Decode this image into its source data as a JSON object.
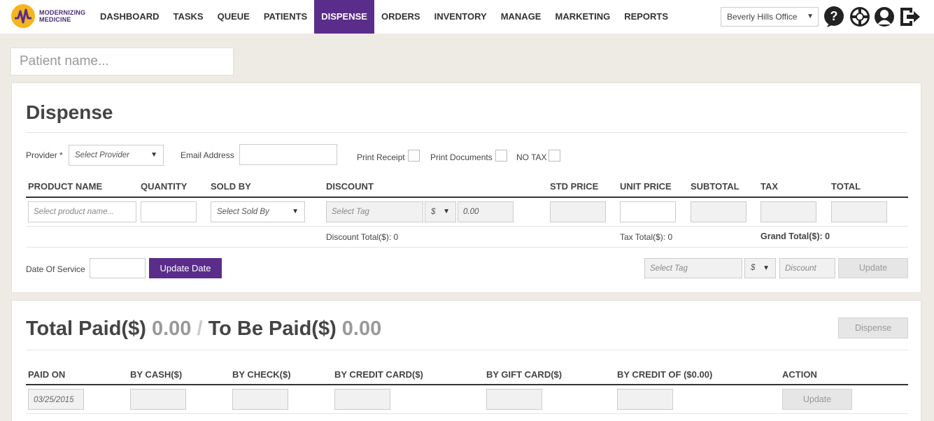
{
  "brand": {
    "line1": "MODERNIZING",
    "line2": "MEDICINE"
  },
  "nav": {
    "items": [
      {
        "label": "DASHBOARD"
      },
      {
        "label": "TASKS"
      },
      {
        "label": "QUEUE"
      },
      {
        "label": "PATIENTS"
      },
      {
        "label": "DISPENSE"
      },
      {
        "label": "ORDERS"
      },
      {
        "label": "INVENTORY"
      },
      {
        "label": "MANAGE"
      },
      {
        "label": "MARKETING"
      },
      {
        "label": "REPORTS"
      }
    ],
    "active": "DISPENSE",
    "office": "Beverly Hills Office",
    "icons": [
      "help-icon",
      "support-lifebuoy-icon",
      "user-profile-icon",
      "logout-icon"
    ]
  },
  "patient_search": {
    "placeholder": "Patient name..."
  },
  "dispense": {
    "title": "Dispense",
    "provider_label": "Provider *",
    "provider_placeholder": "Select Provider",
    "email_label": "Email Address",
    "print_receipt": "Print Receipt",
    "print_documents": "Print Documents",
    "no_tax": "NO TAX",
    "columns": [
      "PRODUCT NAME",
      "QUANTITY",
      "SOLD BY",
      "DISCOUNT",
      "STD PRICE",
      "UNIT PRICE",
      "SUBTOTAL",
      "TAX",
      "TOTAL"
    ],
    "row": {
      "product_placeholder": "Select product name...",
      "sold_by_placeholder": "Select Sold By",
      "tag_placeholder": "Select Tag",
      "discount_type": "$",
      "discount_value": "0.00"
    },
    "discount_total": "Discount Total($): 0",
    "tax_total": "Tax Total($): 0",
    "grand_total": "Grand Total($): 0",
    "date_of_service_label": "Date Of Service",
    "update_date_button": "Update Date",
    "bulk": {
      "tag_placeholder": "Select Tag",
      "type": "$",
      "discount_placeholder": "Discount",
      "update_button": "Update"
    }
  },
  "payment": {
    "total_paid_label": "Total Paid($)",
    "total_paid_value": "0.00",
    "separator": "/",
    "to_be_paid_label": "To Be Paid($)",
    "to_be_paid_value": "0.00",
    "dispense_button": "Dispense",
    "columns": [
      "PAID ON",
      "BY CASH($)",
      "BY CHECK($)",
      "BY CREDIT CARD($)",
      "BY GIFT CARD($)",
      "BY CREDIT OF ($0.00)",
      "ACTION"
    ],
    "row": {
      "paid_on": "03/25/2015",
      "action_button": "Update"
    }
  }
}
